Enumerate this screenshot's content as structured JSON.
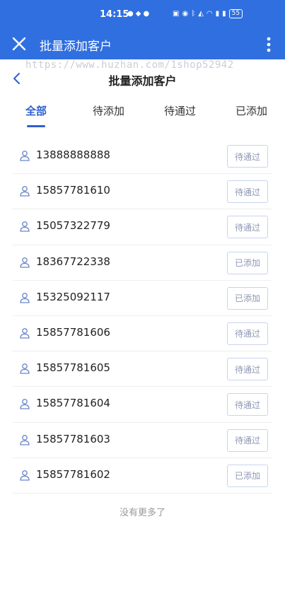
{
  "status_bar": {
    "time": "14:15",
    "battery": "55",
    "icons": [
      "wechat-icon",
      "location-icon",
      "message-icon",
      "nfc-icon",
      "alarm-icon",
      "bluetooth-icon",
      "mute-icon",
      "wifi-icon",
      "signal-icon"
    ]
  },
  "app_bar": {
    "title": "批量添加客户"
  },
  "watermark": "https://www.huzhan.com/1shop52942",
  "page": {
    "title": "批量添加客户"
  },
  "tabs": [
    {
      "label": "全部",
      "active": true
    },
    {
      "label": "待添加",
      "active": false
    },
    {
      "label": "待通过",
      "active": false
    },
    {
      "label": "已添加",
      "active": false
    }
  ],
  "customers": [
    {
      "phone": "13888888888",
      "status": "待通过"
    },
    {
      "phone": "15857781610",
      "status": "待通过"
    },
    {
      "phone": "15057322779",
      "status": "待通过"
    },
    {
      "phone": "18367722338",
      "status": "已添加"
    },
    {
      "phone": "15325092117",
      "status": "已添加"
    },
    {
      "phone": "15857781606",
      "status": "待通过"
    },
    {
      "phone": "15857781605",
      "status": "待通过"
    },
    {
      "phone": "15857781604",
      "status": "待通过"
    },
    {
      "phone": "15857781603",
      "status": "待通过"
    },
    {
      "phone": "15857781602",
      "status": "已添加"
    }
  ],
  "footer": "没有更多了",
  "colors": {
    "brand": "#2f6fe0",
    "accent": "#2f5fd0"
  }
}
